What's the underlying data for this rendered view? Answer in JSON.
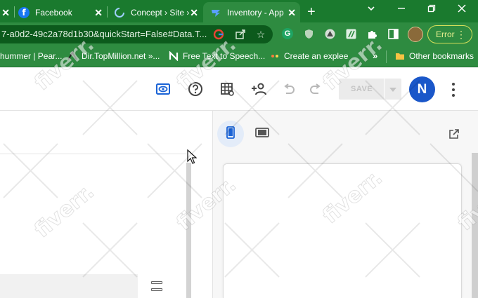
{
  "browser": {
    "tabs": [
      {
        "label": "",
        "icon": "tab-fragment"
      },
      {
        "label": "Facebook",
        "icon": "facebook-icon"
      },
      {
        "label": "Concept › Site ›",
        "icon": "loading-spinner-icon"
      },
      {
        "label": "Inventory - App",
        "icon": "appsheet-icon",
        "active": true
      }
    ],
    "new_tab_glyph": "+",
    "address": "7-a0d2-49c2a78d1b30&quickStart=False#Data.T...",
    "profile_error_label": "Error",
    "bookmarks": [
      {
        "label": "hummer | Pear...",
        "icon": "bookmark-icon"
      },
      {
        "label": "Dir.TopMillion.net »...",
        "icon": "topmillion-icon"
      },
      {
        "label": "Free Text to Speech...",
        "icon": "n-logo-icon"
      },
      {
        "label": "Create an explee",
        "icon": "explee-icon"
      }
    ],
    "bookmarks_overflow": "»",
    "other_bookmarks": "Other bookmarks",
    "colors": {
      "frame": "#1a7a2e",
      "toolbar": "#2e8b40",
      "omnibox": "#0c5a1c"
    }
  },
  "app": {
    "header": {
      "save_label": "SAVE",
      "avatar_initial": "N",
      "avatar_color": "#1a57c9",
      "icons": [
        "preview-eye-icon",
        "help-icon",
        "grid-settings-icon",
        "add-person-icon",
        "undo-icon",
        "redo-icon",
        "more-vert-icon"
      ]
    },
    "preview": {
      "devices": [
        "mobile-icon",
        "tablet-icon"
      ],
      "selected_device": "mobile",
      "open_external": "open-in-new-icon"
    }
  },
  "watermark": {
    "text": "fiverr."
  }
}
